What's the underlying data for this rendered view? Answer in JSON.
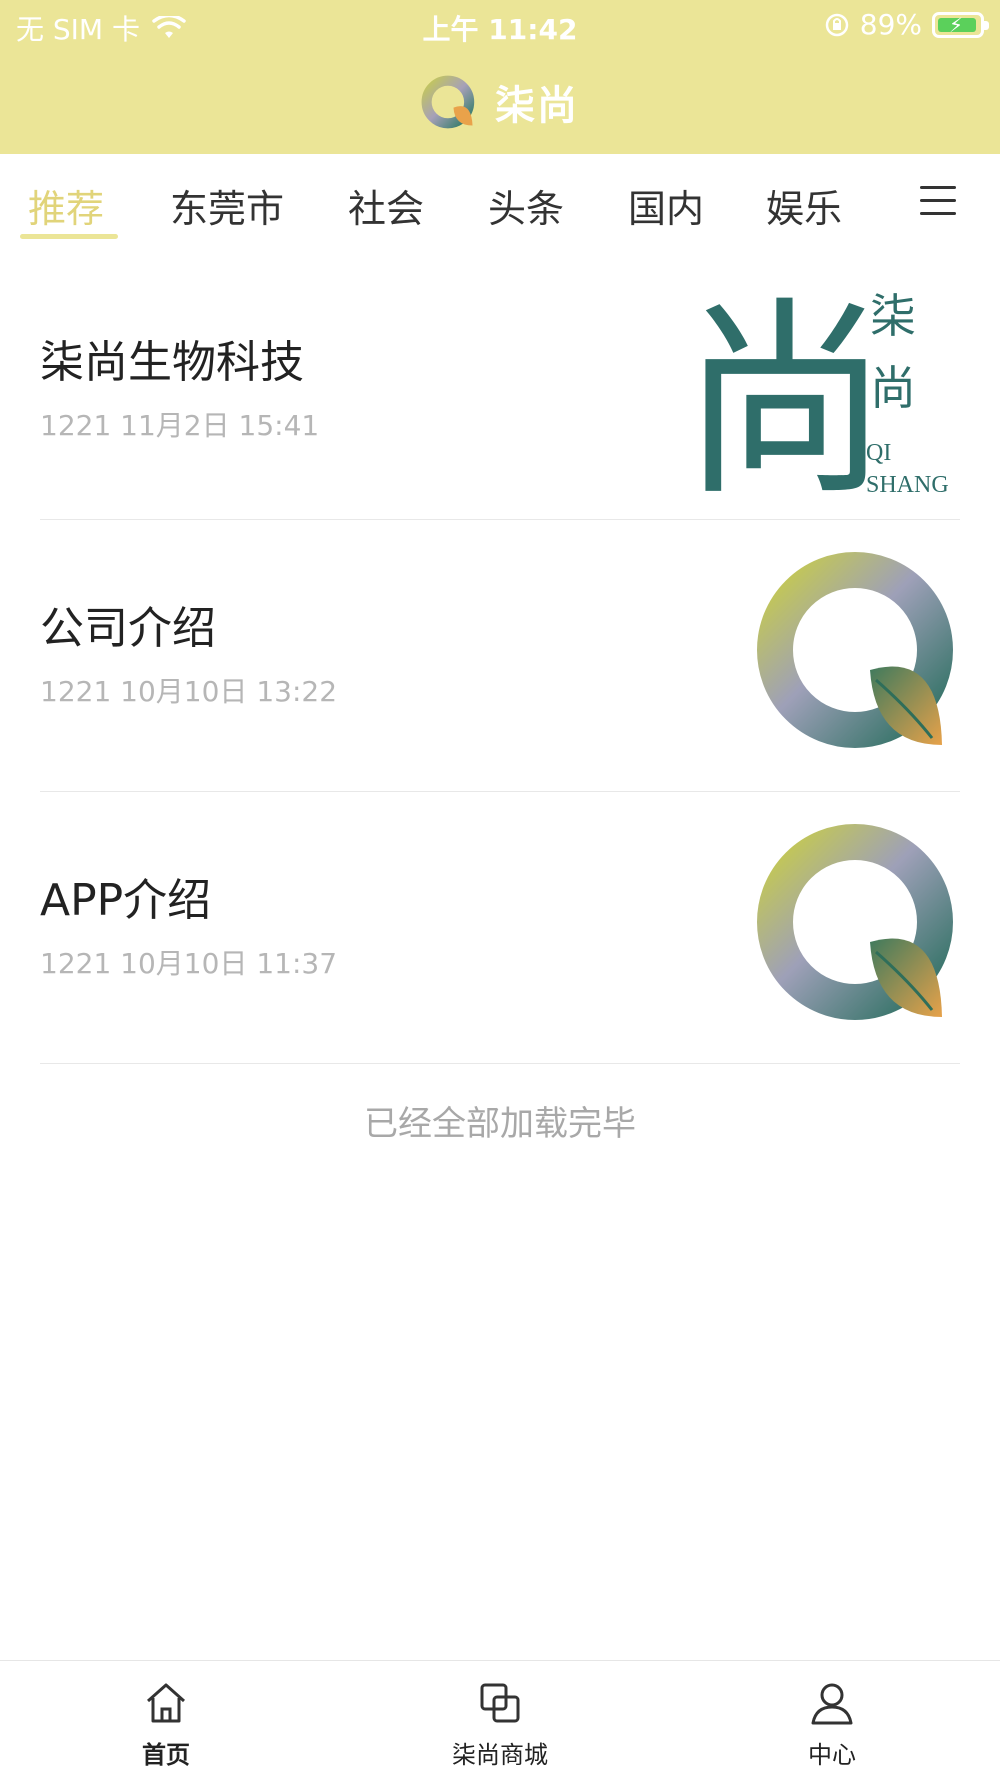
{
  "status_bar": {
    "carrier": "无 SIM 卡",
    "time": "上午 11:42",
    "battery": "89%"
  },
  "header": {
    "title": "柒尚",
    "color": "#ebe597"
  },
  "tabs": [
    "推荐",
    "东莞市",
    "社会",
    "头条",
    "国内",
    "娱乐"
  ],
  "active_tab": "推荐",
  "articles": [
    {
      "title": "柒尚生物科技",
      "meta": "1221  11月2日 15:41",
      "thumb": "qishang-calligraphy-logo"
    },
    {
      "title": "公司介绍",
      "meta": "1221  10月10日 13:22",
      "thumb": "q-leaf-logo"
    },
    {
      "title": "APP介绍",
      "meta": "1221  10月10日 11:37",
      "thumb": "q-leaf-logo"
    }
  ],
  "thumb1_text": {
    "big": "尚",
    "small1": "柒",
    "small2": "尚",
    "latin1": "QI",
    "latin2": "SHANG"
  },
  "end_text": "已经全部加载完毕",
  "bottom_nav": [
    {
      "label": "首页",
      "icon": "home-icon"
    },
    {
      "label": "柒尚商城",
      "icon": "shop-icon"
    },
    {
      "label": "中心",
      "icon": "user-icon"
    }
  ]
}
